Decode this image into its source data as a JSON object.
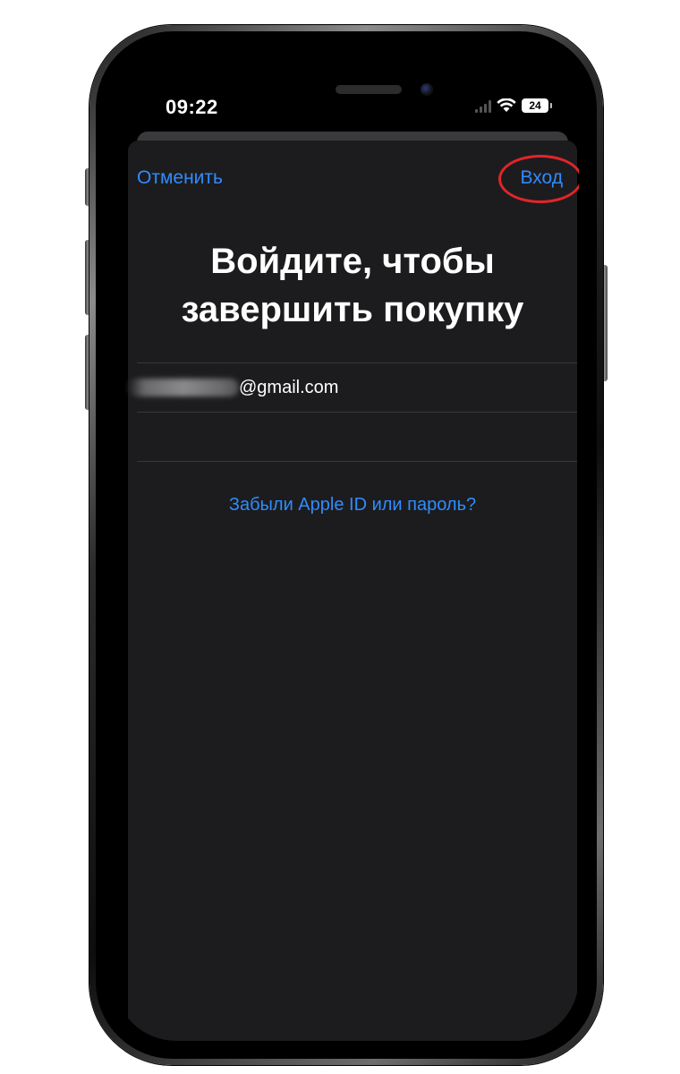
{
  "status_bar": {
    "time": "09:22",
    "battery": "24"
  },
  "nav": {
    "cancel_label": "Отменить",
    "login_label": "Вход"
  },
  "title": "Войдите, чтобы завершить покупку",
  "form": {
    "email_domain": "@gmail.com",
    "password_value": ""
  },
  "forgot_link": "Забыли Apple ID или пароль?",
  "colors": {
    "accent": "#2f8cff",
    "sheet_background": "#1c1c1e",
    "highlight": "#e0252b"
  }
}
